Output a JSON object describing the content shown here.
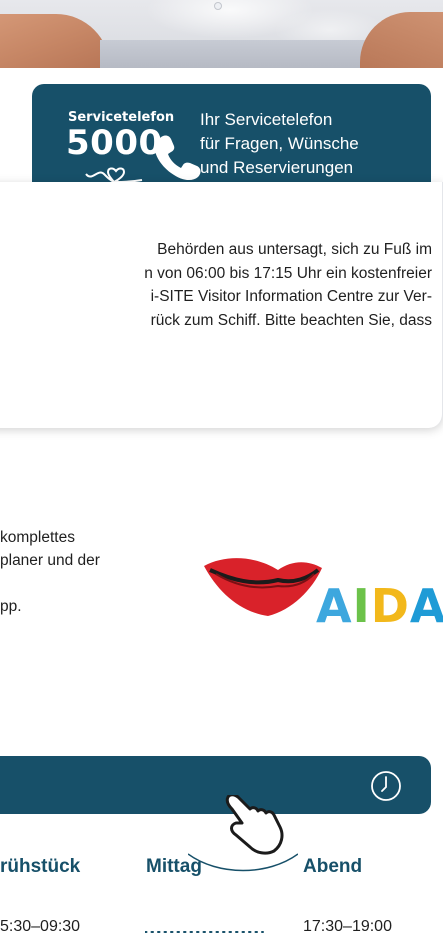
{
  "service_banner": {
    "logo_small": "Servicetelefon",
    "logo_number": "5000",
    "lines": [
      "Ihr Servicetelefon",
      "für Fragen, Wünsche",
      "und Reservierungen"
    ]
  },
  "info_card": {
    "lines": [
      "Behörden aus untersagt, sich zu Fuß im",
      "n von 06:00 bis 17:15 Uhr ein kostenfreier",
      "i-SITE Visitor Information Centre zur Ver-",
      "rück zum Schiff. Bitte beachten Sie, dass"
    ]
  },
  "app_section": {
    "lines": [
      "komplettes",
      "planer und der",
      "",
      "pp."
    ],
    "logo_word": [
      "A",
      "I",
      "D",
      "A"
    ]
  },
  "opening_hours": {
    "headers": {
      "breakfast": "rühstück",
      "lunch": "Mittag",
      "dinner": "Abend"
    },
    "values": {
      "breakfast": "5:30–09:30",
      "dinner": "17:30–19:00"
    }
  },
  "colors": {
    "brand_dark": "#175069",
    "aida_a": "#3da7de",
    "aida_i": "#6cc24a",
    "aida_d": "#f2b81b",
    "aida_a2": "#1f9bd6",
    "lips": "#d9222a"
  }
}
